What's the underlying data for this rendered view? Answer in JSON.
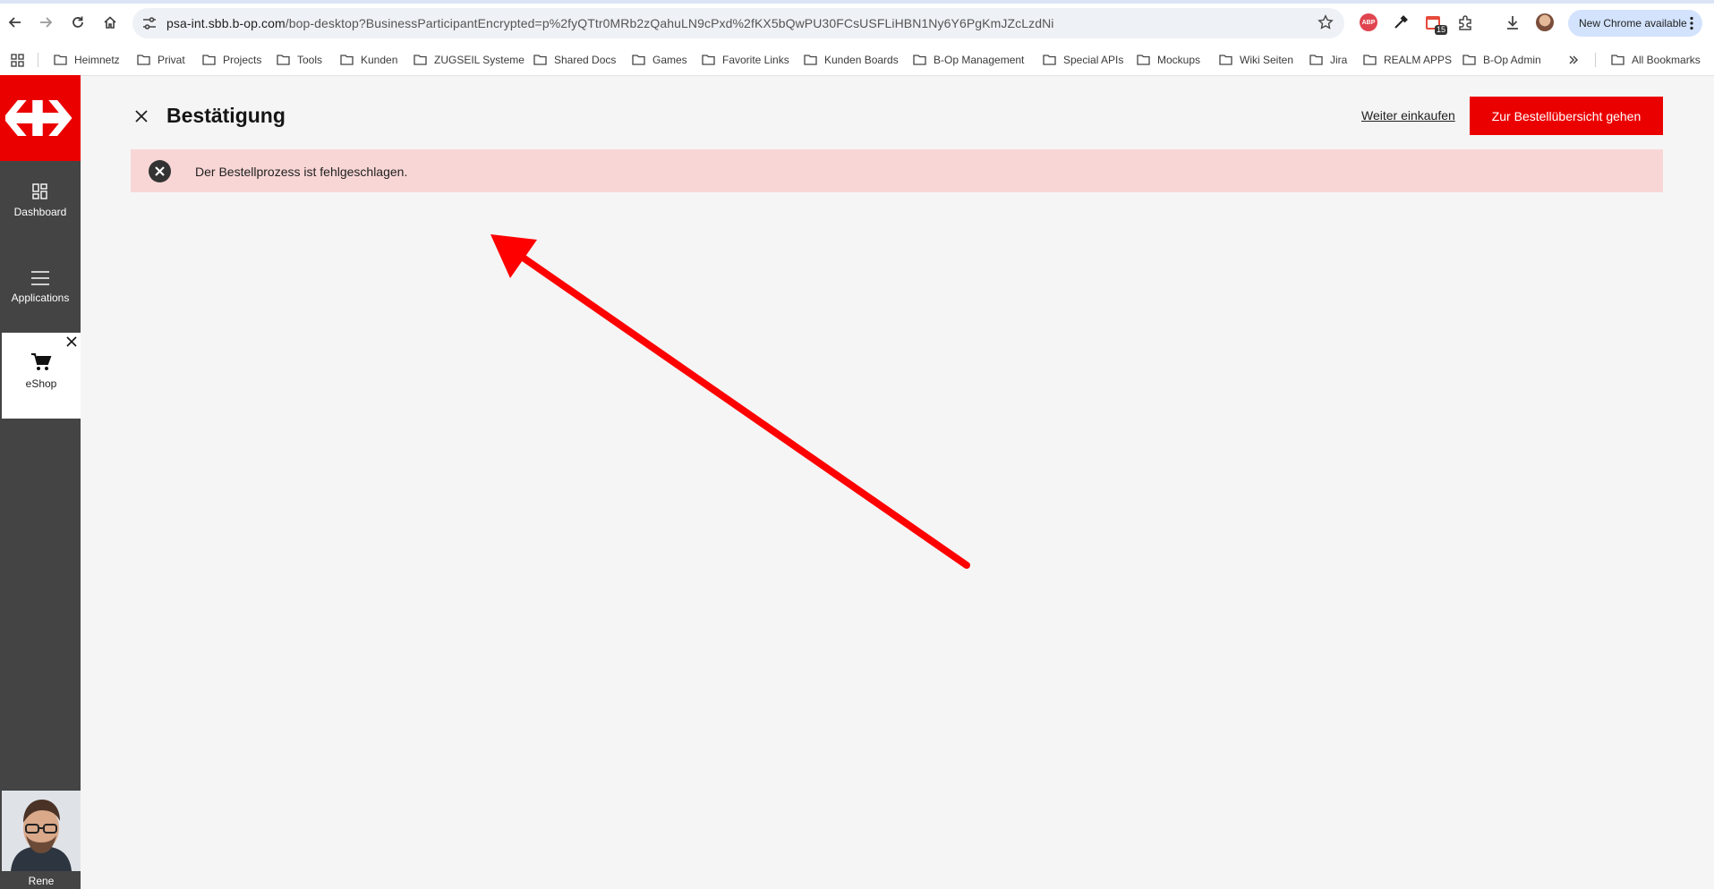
{
  "browser": {
    "url_host": "psa-int.sbb.b-op.com",
    "url_path": "/bop-desktop?BusinessParticipantEncrypted=p%2fyQTtr0MRb2zQahuLN9cPxd%2fKX5bQwPU30FCsUSFLiHBN1Ny6Y6PgKmJZcLzdNi",
    "update_label": "New Chrome available",
    "calendar_badge": "15",
    "abp_label": "ABP",
    "bookmarks": [
      "Heimnetz",
      "Privat",
      "Projects",
      "Tools",
      "Kunden",
      "ZUGSEIL Systeme",
      "Shared Docs",
      "Games",
      "Favorite Links",
      "Kunden Boards",
      "B-Op Management",
      "Special APIs",
      "Mockups",
      "Wiki Seiten",
      "Jira",
      "REALM APPS",
      "B-Op Admin"
    ],
    "all_bookmarks": "All Bookmarks"
  },
  "sidebar": {
    "dashboard": "Dashboard",
    "applications": "Applications",
    "eshop": "eShop",
    "user_name": "Rene"
  },
  "main": {
    "title": "Bestätigung",
    "continue_shopping": "Weiter einkaufen",
    "order_overview_button": "Zur Bestellübersicht gehen",
    "error_message": "Der Bestellprozess ist fehlgeschlagen."
  },
  "colors": {
    "brand_red": "#eb0000",
    "error_bg": "#f9d6d6",
    "sidebar_bg": "#444444",
    "annotation": "#ff0000"
  }
}
